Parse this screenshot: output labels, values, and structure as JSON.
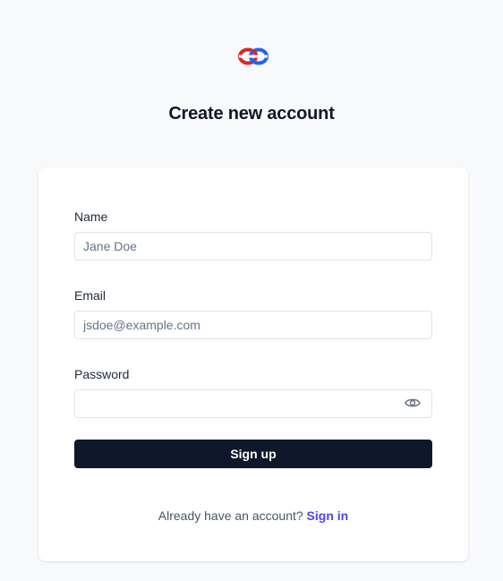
{
  "logo": {
    "icon": "chain-link-logo-icon",
    "colors": {
      "red": "#dc2626",
      "blue": "#2563eb"
    }
  },
  "header": {
    "title": "Create new account"
  },
  "form": {
    "name": {
      "label": "Name",
      "value": "",
      "placeholder": "Jane Doe"
    },
    "email": {
      "label": "Email",
      "value": "",
      "placeholder": "jsdoe@example.com"
    },
    "password": {
      "label": "Password",
      "value": "",
      "placeholder": "",
      "toggle_icon": "eye-icon"
    },
    "submit_label": "Sign up"
  },
  "footer": {
    "prompt": "Already have an account?",
    "signin_label": "Sign in"
  },
  "colors": {
    "background": "#f7f9fb",
    "card": "#ffffff",
    "button": "#0f172a",
    "link": "#4f46e5"
  }
}
